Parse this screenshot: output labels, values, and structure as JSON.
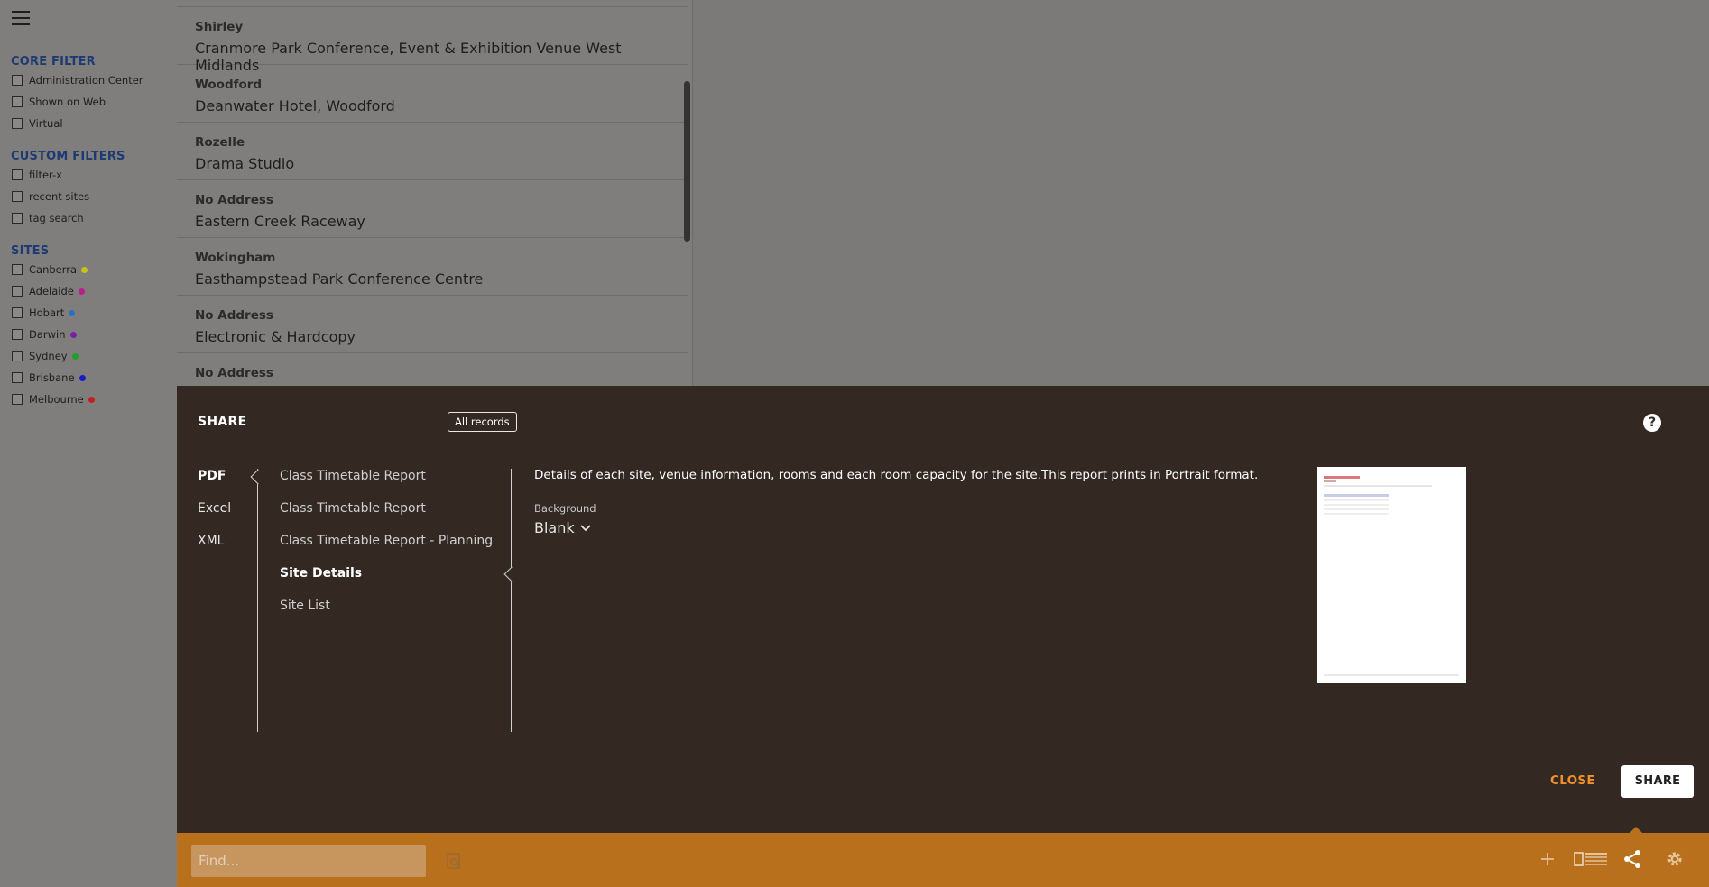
{
  "sidebar": {
    "sections": [
      {
        "title": "CORE FILTER",
        "items": [
          {
            "label": "Administration Center"
          },
          {
            "label": "Shown on Web"
          },
          {
            "label": "Virtual"
          }
        ]
      },
      {
        "title": "CUSTOM FILTERS",
        "items": [
          {
            "label": "filter-x"
          },
          {
            "label": "recent sites"
          },
          {
            "label": "tag search"
          }
        ]
      },
      {
        "title": "SITES",
        "items": [
          {
            "label": "Canberra",
            "color": "#c9c21a"
          },
          {
            "label": "Adelaide",
            "color": "#b81e8c"
          },
          {
            "label": "Hobart",
            "color": "#2a6fc4"
          },
          {
            "label": "Darwin",
            "color": "#7a1ea8"
          },
          {
            "label": "Sydney",
            "color": "#1e9e2a"
          },
          {
            "label": "Brisbane",
            "color": "#1a1ac4"
          },
          {
            "label": "Melbourne",
            "color": "#c41e1e"
          }
        ]
      }
    ]
  },
  "records": [
    {
      "location": "Shirley",
      "name": "Cranmore Park Conference, Event & Exhibition Venue West Midlands"
    },
    {
      "location": "Woodford",
      "name": "Deanwater Hotel, Woodford"
    },
    {
      "location": "Rozelle",
      "name": "Drama Studio"
    },
    {
      "location": "No Address",
      "name": "Eastern Creek Raceway"
    },
    {
      "location": "Wokingham",
      "name": "Easthampstead Park Conference Centre"
    },
    {
      "location": "No Address",
      "name": "Electronic & Hardcopy"
    },
    {
      "location": "No Address",
      "name": ""
    }
  ],
  "share": {
    "title": "SHARE",
    "scope_button": "All records",
    "help": "?",
    "formats": [
      "PDF",
      "Excel",
      "XML"
    ],
    "active_format": "PDF",
    "reports": [
      "Class Timetable Report",
      "Class Timetable Report",
      "Class Timetable Report - Planning",
      "Site Details",
      "Site List"
    ],
    "active_report": "Site Details",
    "description": "Details of each site, venue information, rooms and each room capacity for the site.This report prints in Portrait format.",
    "background_label": "Background",
    "background_value": "Blank",
    "close_label": "CLOSE",
    "share_label": "SHARE"
  },
  "toolbar": {
    "find_placeholder": "Find..."
  },
  "colors": {
    "panel_bg": "#332922",
    "toolbar_bg": "#b8701c",
    "accent": "#f0902a",
    "section_title": "#1d3a73"
  }
}
